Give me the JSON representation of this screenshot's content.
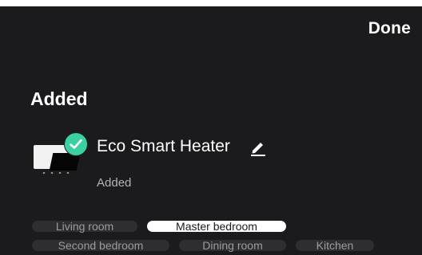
{
  "header": {
    "done_label": "Done"
  },
  "section": {
    "title": "Added"
  },
  "device": {
    "name": "Eco Smart Heater",
    "status": "Added",
    "thumbnail_icon": "heater-device-icon",
    "badge_icon": "check-circle-icon",
    "edit_icon": "pencil-icon"
  },
  "rooms": {
    "row1": [
      {
        "label": "Living room",
        "selected": false
      },
      {
        "label": "Master bedroom",
        "selected": true
      }
    ],
    "row2": [
      {
        "label": "Second bedroom",
        "selected": false
      },
      {
        "label": "Dining room",
        "selected": false
      },
      {
        "label": "Kitchen",
        "selected": false
      }
    ]
  },
  "colors": {
    "background": "#1b1b1d",
    "accent_check": "#3ad0a0",
    "chip_bg": "#2e2e31",
    "chip_selected_bg": "#ffffff"
  }
}
